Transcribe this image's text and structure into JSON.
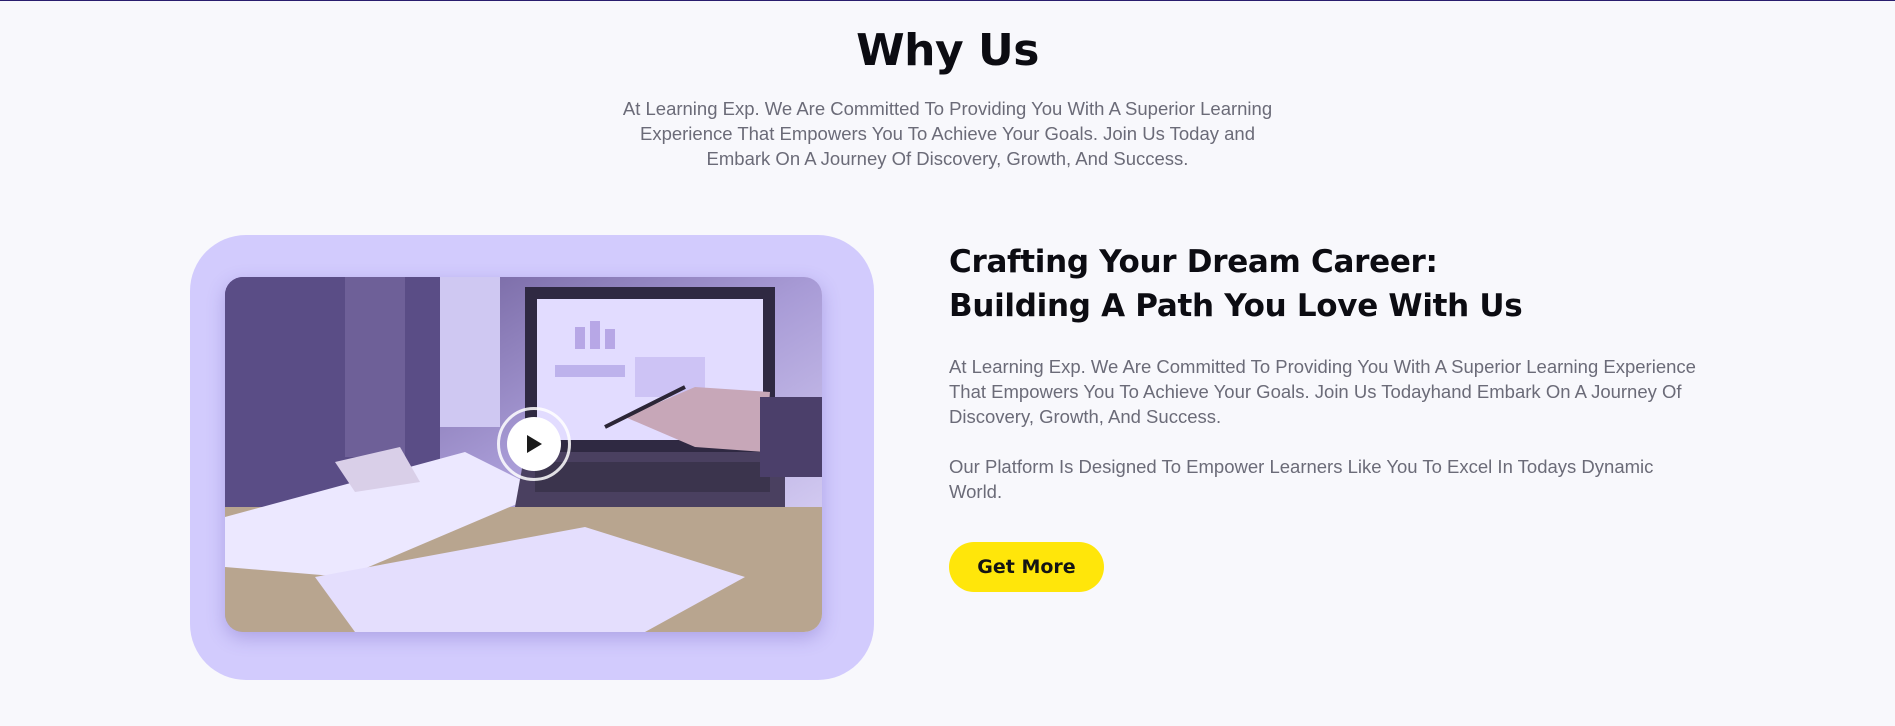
{
  "why_us": {
    "title": "Why Us",
    "description": "At Learning Exp. We Are Committed To Providing You With A Superior Learning Experience That Empowers You To Achieve Your Goals. Join Us Today and Embark On A Journey Of Discovery, Growth, And Success."
  },
  "feature": {
    "title_line1": "Crafting Your Dream Career:",
    "title_line2": "Building A Path You Love With Us",
    "paragraph1": "At Learning Exp. We Are Committed To Providing You With A Superior Learning Experience That Empowers You To Achieve Your Goals. Join Us Todayhand Embark On A Journey Of Discovery, Growth, And Success.",
    "paragraph2": "Our Platform Is Designed To Empower Learners Like You To Excel In Todays Dynamic World.",
    "cta_label": "Get More"
  },
  "media": {
    "play_icon": "play-icon",
    "card_color": "#d2cbfd"
  },
  "colors": {
    "accent_yellow": "#ffe60a",
    "card_lavender": "#d2cbfd",
    "heading": "#0c0c12",
    "body_text": "#6b6b78"
  }
}
